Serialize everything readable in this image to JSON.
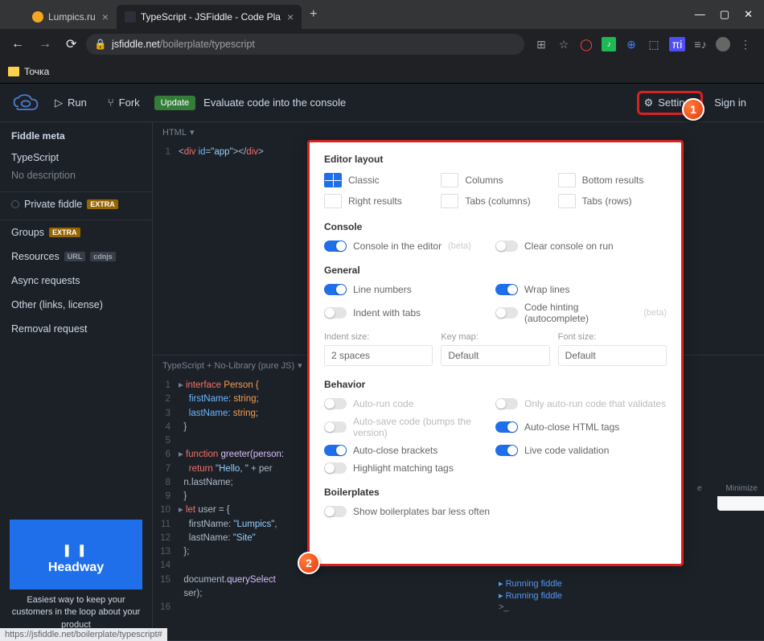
{
  "browser": {
    "tabs": [
      {
        "title": "Lumpics.ru",
        "active": false
      },
      {
        "title": "TypeScript - JSFiddle - Code Pla",
        "active": true
      }
    ],
    "url_host": "jsfiddle.net",
    "url_path": "/boilerplate/typescript",
    "bookmark": "Точка",
    "status_link": "https://jsfiddle.net/boilerplate/typescript#"
  },
  "toolbar": {
    "run": "Run",
    "fork": "Fork",
    "update": "Update",
    "eval_text": "Evaluate code into the console",
    "settings": "Settings",
    "signin": "Sign in"
  },
  "sidebar": {
    "meta_title": "Fiddle meta",
    "fiddle_name": "TypeScript",
    "description": "No description",
    "private": "Private fiddle",
    "groups": "Groups",
    "resources": "Resources",
    "url": "URL",
    "cdnjs": "cdnjs",
    "async": "Async requests",
    "other": "Other (links, license)",
    "removal": "Removal request",
    "extra": "EXTRA",
    "ad_brand": "Headway",
    "ad_copy": "Easiest way to keep your customers in the loop about your product"
  },
  "editors": {
    "html_label": "HTML",
    "html_code": "<div id=\"app\"></div>",
    "js_label": "TypeScript + No-Library (pure JS)"
  },
  "code_lines": {
    "l1a": "interface",
    "l1b": " Person {",
    "l2a": "firstName",
    "l2b": ": ",
    "l2c": "string",
    "l2d": ";",
    "l3a": "lastName",
    "l3b": ": ",
    "l3c": "string",
    "l3d": ";",
    "l4": "}",
    "l6a": "function",
    "l6b": " greeter(person:",
    "l7a": "return",
    "l7b": " ",
    "l7c": "\"Hello, \"",
    "l7d": " + per",
    "l8": "n.lastName;",
    "l9": "}",
    "l10a": "let",
    "l10b": " user = {",
    "l11a": "firstName: ",
    "l11b": "\"Lumpics\"",
    "l11c": ",",
    "l12a": "lastName: ",
    "l12b": "\"Site\"",
    "l13": "};",
    "l15a": "document.",
    "l15b": "querySelect",
    "l15c": "ser);"
  },
  "console": {
    "running": "Running fiddle",
    "prompt": ">_"
  },
  "right": {
    "minimize": "Minimize"
  },
  "settings": {
    "layout_title": "Editor layout",
    "layouts": {
      "classic": "Classic",
      "columns": "Columns",
      "bottom": "Bottom results",
      "right": "Right results",
      "tabs_col": "Tabs (columns)",
      "tabs_row": "Tabs (rows)"
    },
    "console_title": "Console",
    "console_editor": "Console in the editor",
    "clear_console": "Clear console on run",
    "general_title": "General",
    "line_numbers": "Line numbers",
    "wrap_lines": "Wrap lines",
    "indent_tabs": "Indent with tabs",
    "code_hinting": "Code hinting (autocomplete)",
    "indent_size_label": "Indent size:",
    "indent_size": "2 spaces",
    "keymap_label": "Key map:",
    "keymap": "Default",
    "fontsize_label": "Font size:",
    "fontsize": "Default",
    "behavior_title": "Behavior",
    "autorun": "Auto-run code",
    "autorun_valid": "Only auto-run code that validates",
    "autosave": "Auto-save code (bumps the version)",
    "autoclose_html": "Auto-close HTML tags",
    "autoclose_brackets": "Auto-close brackets",
    "live_valid": "Live code validation",
    "highlight_tags": "Highlight matching tags",
    "boilerplates_title": "Boilerplates",
    "boilerplates_less": "Show boilerplates bar less often",
    "beta": "(beta)"
  },
  "callouts": {
    "c1": "1",
    "c2": "2"
  }
}
